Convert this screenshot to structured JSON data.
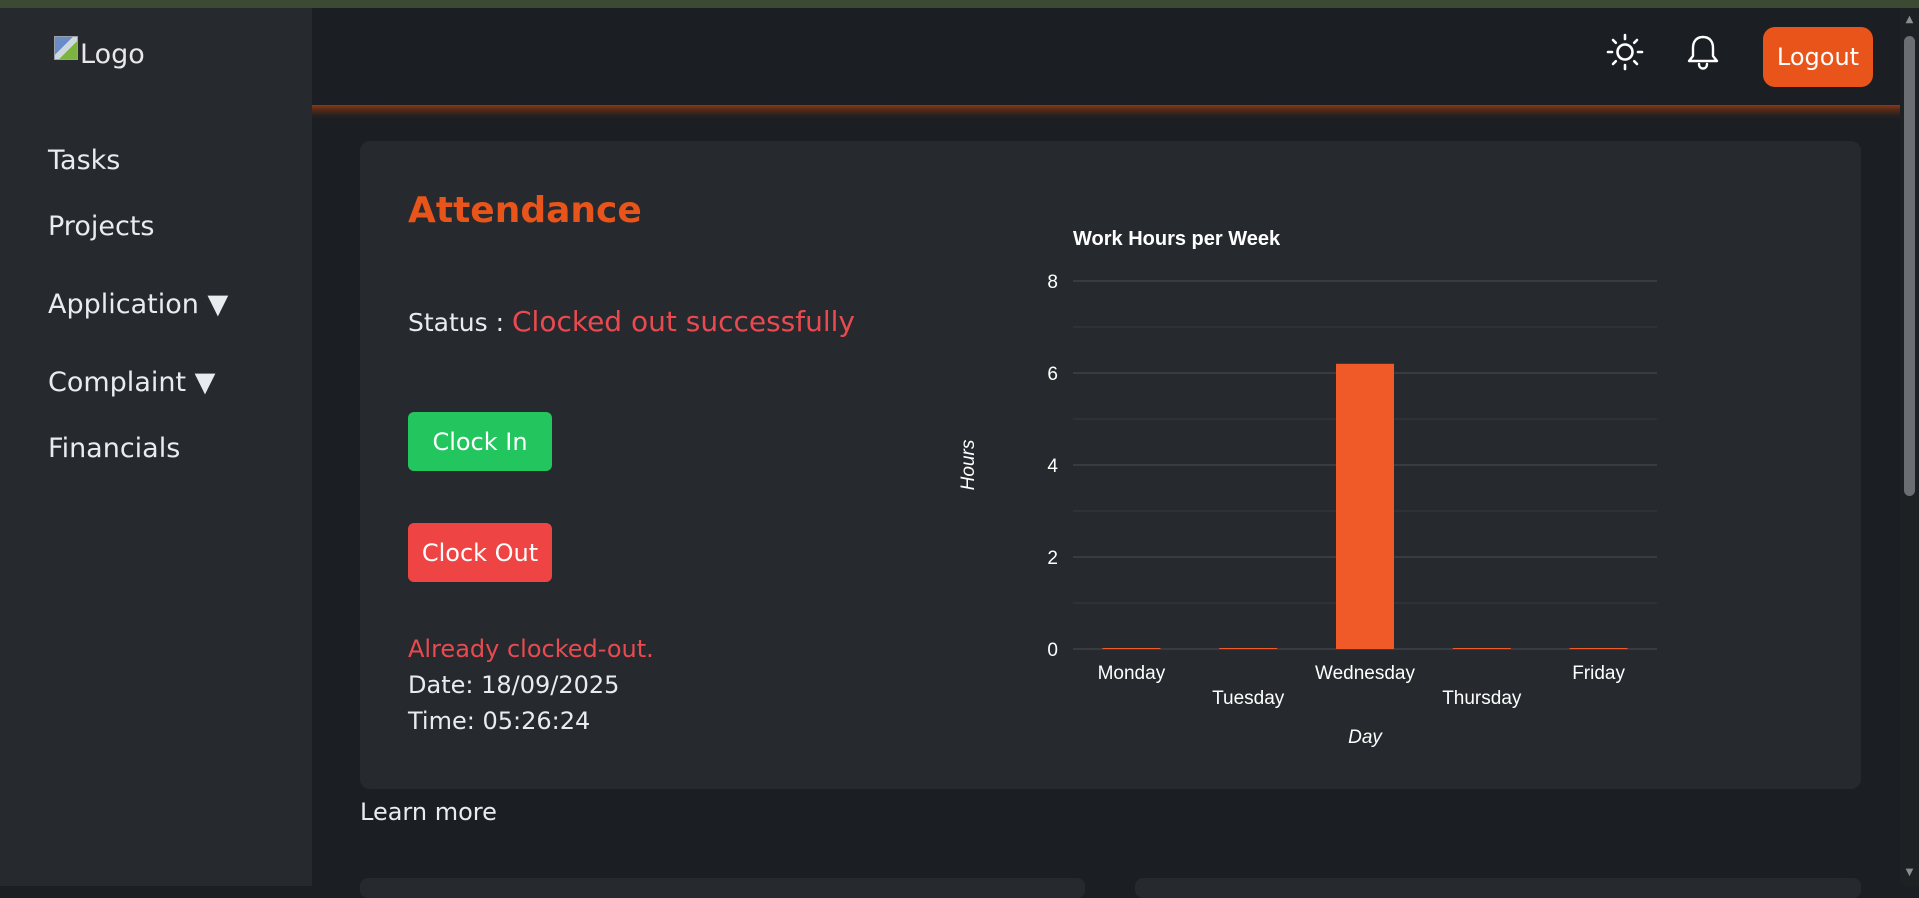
{
  "sidebar": {
    "logo_alt": "Logo",
    "items": [
      {
        "label": "Tasks"
      },
      {
        "label": "Projects"
      },
      {
        "label": "Application ▼"
      },
      {
        "label": "Complaint ▼"
      },
      {
        "label": "Financials"
      }
    ]
  },
  "header": {
    "theme_icon": "sun-icon",
    "notification_icon": "bell-icon",
    "logout_label": "Logout"
  },
  "attendance": {
    "title": "Attendance",
    "status_label": "Status :",
    "status_value": "Clocked out successfully",
    "clock_in_label": "Clock In",
    "clock_out_label": "Clock Out",
    "message": "Already clocked-out.",
    "date_text": "Date: 18/09/2025",
    "time_text": "Time: 05:26:24",
    "learn_more": "Learn more"
  },
  "colors": {
    "accent": "#e8541a",
    "success": "#22c55e",
    "danger": "#ef4444",
    "bar": "#f05a28"
  },
  "chart_data": {
    "type": "bar",
    "title": "Work Hours per Week",
    "xlabel": "Day",
    "ylabel": "Hours",
    "categories": [
      "Monday",
      "Tuesday",
      "Wednesday",
      "Thursday",
      "Friday"
    ],
    "values": [
      0,
      0,
      6.2,
      0,
      0
    ],
    "ylim": [
      0,
      8
    ],
    "yticks": [
      0,
      2,
      4,
      6,
      8
    ],
    "grid": true,
    "legend": "none"
  }
}
